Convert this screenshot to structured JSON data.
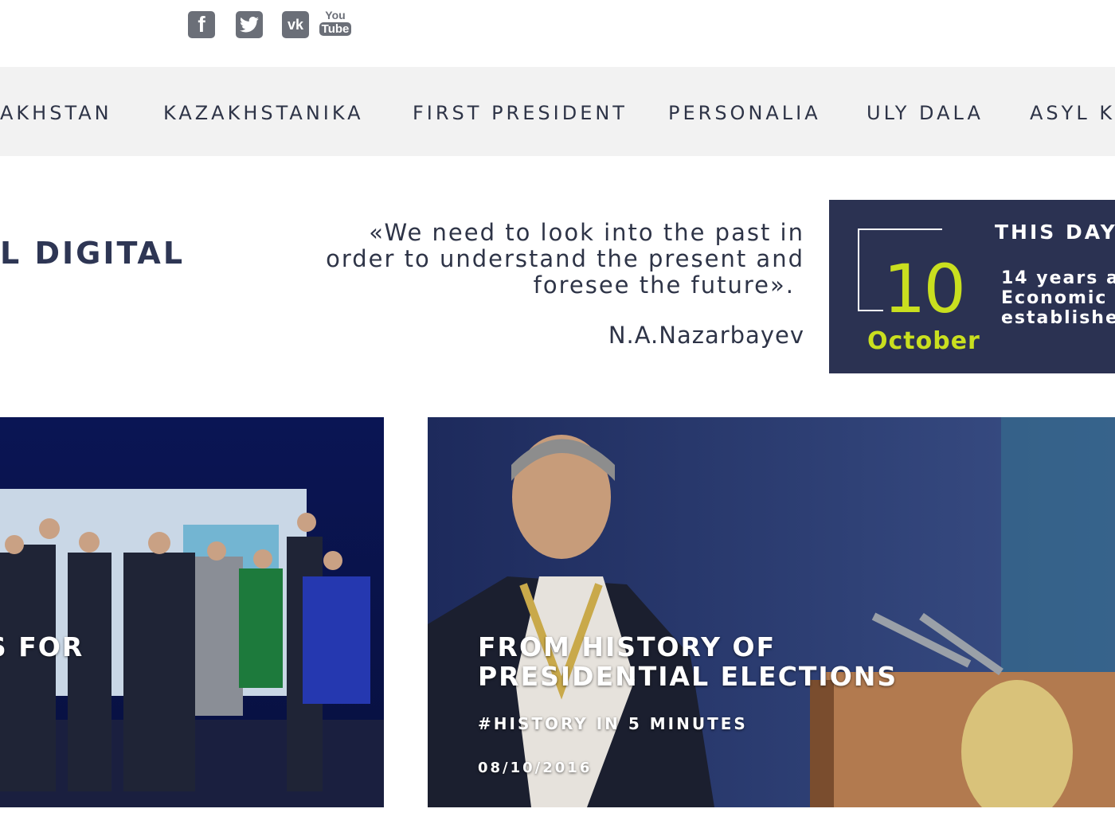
{
  "social": {
    "facebook_icon": "facebook-icon",
    "twitter_icon": "twitter-icon",
    "vk_icon": "vk-icon",
    "youtube_icon": "youtube-icon",
    "youtube_top": "You",
    "youtube_bottom": "Tube",
    "vk_text": "vk",
    "fb_text": "f"
  },
  "nav": {
    "items": [
      "AKHSTAN",
      "KAZAKHSTANIKA",
      "FIRST PRESIDENT",
      "PERSONALIA",
      "ULY DALA",
      "ASYL K"
    ]
  },
  "header": {
    "logo_fragment": "L DIGITAL"
  },
  "quote": {
    "line1": "«We need to look into the past in",
    "line2": "order to understand the present and",
    "line3": "foresee the future».",
    "author": "N.A.Nazarbayev"
  },
  "this_day": {
    "title": "THIS DAY",
    "day": "10",
    "month": "October",
    "line1": "14 years a",
    "line2": "Economic",
    "line3": "establishe"
  },
  "cards": [
    {
      "title_line1": "S FOR",
      "image_desc": "group-photo"
    },
    {
      "title_line1": "FROM HISTORY OF",
      "title_line2": "PRESIDENTIAL ELECTIONS",
      "tag": "#HISTORY IN 5 MINUTES",
      "date": "08/10/2016"
    }
  ],
  "colors": {
    "navy": "#2b3252",
    "accent": "#c9df1f",
    "nav_bg": "#f2f2f2"
  }
}
